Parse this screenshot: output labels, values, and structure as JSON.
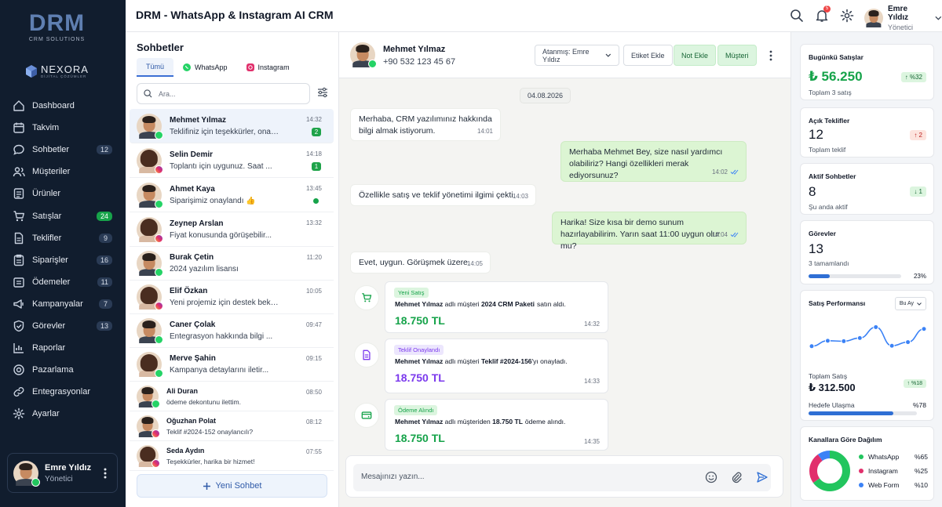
{
  "app": {
    "title": "DRM - WhatsApp & Instagram AI CRM",
    "logo": "DRM",
    "logo_sub": "CRM SOLUTIONS",
    "partner": "NEXORA",
    "partner_sub": "DİJİTAL ÇÖZÜMLER"
  },
  "sidebar": {
    "items": [
      {
        "label": "Dashboard",
        "icon": "home-icon",
        "badge": ""
      },
      {
        "label": "Takvim",
        "icon": "calendar-icon",
        "badge": ""
      },
      {
        "label": "Sohbetler",
        "icon": "chat-icon",
        "badge": "12"
      },
      {
        "label": "Müşteriler",
        "icon": "users-icon",
        "badge": ""
      },
      {
        "label": "Ürünler",
        "icon": "box-icon",
        "badge": ""
      },
      {
        "label": "Satışlar",
        "icon": "cart-icon",
        "badge": "24"
      },
      {
        "label": "Teklifler",
        "icon": "file-icon",
        "badge": "9"
      },
      {
        "label": "Siparişler",
        "icon": "clipboard-icon",
        "badge": "16"
      },
      {
        "label": "Ödemeler",
        "icon": "wallet-icon",
        "badge": "11"
      },
      {
        "label": "Kampanyalar",
        "icon": "megaphone-icon",
        "badge": "7"
      },
      {
        "label": "Görevler",
        "icon": "check-icon",
        "badge": "13"
      },
      {
        "label": "Raporlar",
        "icon": "chart-icon",
        "badge": ""
      },
      {
        "label": "Pazarlama",
        "icon": "target-icon",
        "badge": ""
      },
      {
        "label": "Entegrasyonlar",
        "icon": "link-icon",
        "badge": ""
      },
      {
        "label": "Ayarlar",
        "icon": "gear-icon",
        "badge": ""
      }
    ],
    "user": {
      "name": "Emre Yıldız",
      "role": "Yönetici"
    }
  },
  "header": {
    "notifications": "5",
    "user_name": "Emre Yıldız",
    "user_role": "Yönetici"
  },
  "chatlist": {
    "title": "Sohbetler",
    "tabs": [
      "Tümü",
      "WhatsApp",
      "Instagram"
    ],
    "search_placeholder": "Ara...",
    "new_chat": "Yeni Sohbet",
    "rows": [
      {
        "name": "Mehmet Yılmaz",
        "msg": "Teklifiniz için teşekkürler, onaylı...",
        "time": "14:32",
        "unread": "2",
        "channel": "wa",
        "gender": "m"
      },
      {
        "name": "Selin Demir",
        "msg": "Toplantı için uygunuz. Saat ...",
        "time": "14:18",
        "unread": "1",
        "channel": "ig",
        "gender": "f"
      },
      {
        "name": "Ahmet Kaya",
        "msg": "Siparişimiz onaylandı 👍",
        "time": "13:45",
        "unread": "",
        "channel": "wa",
        "gender": "m"
      },
      {
        "name": "Zeynep Arslan",
        "msg": "Fiyat konusunda görüşebilir...",
        "time": "13:32",
        "unread": "",
        "channel": "ig",
        "gender": "f"
      },
      {
        "name": "Burak Çetin",
        "msg": "2024 yazılım lisansı",
        "time": "11:20",
        "unread": "",
        "channel": "wa",
        "gender": "m"
      },
      {
        "name": "Elif Özkan",
        "msg": "Yeni projemiz için destek bekli...",
        "time": "10:05",
        "unread": "",
        "channel": "ig",
        "gender": "f"
      },
      {
        "name": "Caner Çolak",
        "msg": "Entegrasyon hakkında bilgi ...",
        "time": "09:47",
        "unread": "",
        "channel": "wa",
        "gender": "m"
      },
      {
        "name": "Merve Şahin",
        "msg": "Kampanya detaylarını iletir...",
        "time": "09:15",
        "unread": "",
        "channel": "wa",
        "gender": "f"
      },
      {
        "name": "Ali Duran",
        "msg": "ödeme dekontunu ilettim.",
        "time": "08:50",
        "unread": "",
        "channel": "wa",
        "gender": "m"
      },
      {
        "name": "Oğuzhan Polat",
        "msg": "Teklif #2024-152 onaylancılı?",
        "time": "08:12",
        "unread": "",
        "channel": "ig",
        "gender": "m"
      },
      {
        "name": "Seda Aydın",
        "msg": "Teşekkürler, harika bir hizmet!",
        "time": "07:55",
        "unread": "",
        "channel": "ig",
        "gender": "f"
      }
    ]
  },
  "chat": {
    "contact_name": "Mehmet Yılmaz",
    "contact_phone": "+90 532 123 45 67",
    "assign_label": "Atanmış: Emre Yıldız",
    "tag_button": "Etiket Ekle",
    "note_button": "Not Ekle",
    "customer_button": "Müşteri",
    "date": "04.08.2026",
    "messages": [
      {
        "dir": "in",
        "text": "Merhaba, CRM yazılımınız hakkında bilgi almak istiyorum.",
        "time": "14:01"
      },
      {
        "dir": "out",
        "text": "Merhaba Mehmet Bey, size nasıl yardımcı olabiliriz? Hangi özellikleri merak ediyorsunuz?",
        "time": "14:02"
      },
      {
        "dir": "in",
        "text": "Özellikle satış ve teklif yönetimi ilgimi çekti.",
        "time": "14:03"
      },
      {
        "dir": "out",
        "text": "Harika! Size kısa bir demo sunum hazırlayabilirim. Yarın saat 11:00 uygun olur mu?",
        "time": "14:04"
      },
      {
        "dir": "in",
        "text": "Evet, uygun. Görüşmek üzere.",
        "time": "14:05"
      }
    ],
    "events": [
      {
        "tag": "Yeni Satış",
        "text_pre": "adlı müşteri",
        "bold_name": "Mehmet Yılmaz",
        "bold_obj": "2024 CRM Paketi",
        "text_post": "satın aldı.",
        "amount": "18.750 TL",
        "time": "14:32",
        "color": "#16a34a",
        "tagbg": "#dcf5df"
      },
      {
        "tag": "Teklif Onaylandı",
        "text_pre": "adlı müşteri",
        "bold_name": "Mehmet Yılmaz",
        "bold_obj": "Teklif #2024-156",
        "text_post": "'yı onayladı.",
        "amount": "18.750 TL",
        "time": "14:33",
        "color": "#7c3aed",
        "tagbg": "#ece6fd"
      },
      {
        "tag": "Ödeme Alındı",
        "text_pre": "adlı müşteriden",
        "bold_name": "Mehmet Yılmaz",
        "bold_obj": "18.750 TL",
        "text_post": "ödeme alındı.",
        "amount": "18.750 TL",
        "time": "14:35",
        "color": "#16a34a",
        "tagbg": "#dcf5df"
      }
    ],
    "input_placeholder": "Mesajınızı yazın..."
  },
  "stats": {
    "sales": {
      "label": "Bugünkü Satışlar",
      "value": "₺ 56.250",
      "sub": "Toplam 3 satış",
      "change": "%32"
    },
    "offers": {
      "label": "Açık Teklifler",
      "value": "12",
      "sub": "Toplam teklif",
      "change": "2"
    },
    "chats": {
      "label": "Aktif Sohbetler",
      "value": "8",
      "sub": "Şu anda aktif",
      "change": "1"
    },
    "tasks": {
      "label": "Görevler",
      "value": "13",
      "sub": "3 tamamlandı",
      "percent": "23%",
      "progress": 0.23
    },
    "performance": {
      "label": "Satış Performansı",
      "period": "Bu Ay",
      "total_label": "Toplam Satış",
      "total": "₺ 312.500",
      "change": "%18",
      "goal_label": "Hedefe Ulaşma",
      "goal": "%78",
      "goal_progress": 0.78
    },
    "channels": {
      "label": "Kanallara Göre Dağılım",
      "items": [
        {
          "name": "WhatsApp",
          "pct": "%65",
          "value": 65,
          "color": "#22c55e"
        },
        {
          "name": "Instagram",
          "pct": "%25",
          "value": 25,
          "color": "#e1306c"
        },
        {
          "name": "Web Form",
          "pct": "%10",
          "value": 10,
          "color": "#3b82f6"
        }
      ]
    }
  },
  "chart_data": {
    "type": "line",
    "title": "Satış Performansı",
    "xlabel": "",
    "ylabel": "",
    "x": [
      1,
      2,
      3,
      4,
      5,
      6,
      7,
      8
    ],
    "series": [
      {
        "values": [
          40,
          52,
          51,
          58,
          82,
          41,
          49,
          78
        ]
      }
    ],
    "ylim": [
      0,
      100
    ],
    "grid": false,
    "color": "#3b82f6"
  }
}
